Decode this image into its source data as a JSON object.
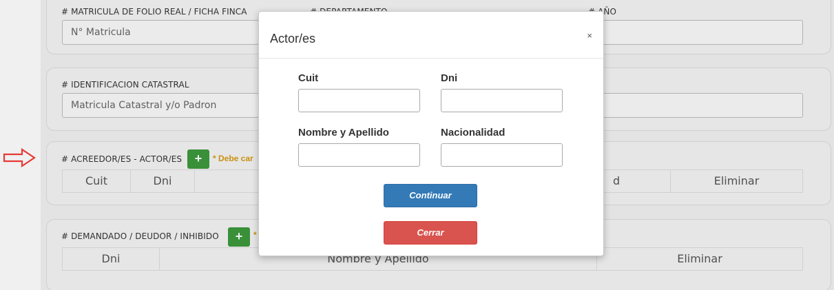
{
  "background": {
    "matricula": {
      "label": "# MATRICULA DE FOLIO REAL / FICHA FINCA",
      "placeholder": "N° Matricula"
    },
    "departamento": {
      "label": "# DEPARTAMENTO"
    },
    "anio": {
      "label": "# AÑO"
    },
    "catastral": {
      "label": "# IDENTIFICACION CATASTRAL",
      "placeholder": "Matricula Catastral y/o Padron"
    },
    "acreedor": {
      "label": "# ACREEDOR/ES - ACTOR/ES",
      "warning": "* Debe car",
      "columns": [
        "Cuit",
        "Dni",
        "",
        "d",
        "Eliminar"
      ]
    },
    "demandado": {
      "label": "# DEMANDADO / DEUDOR / INHIBIDO",
      "warning": "*",
      "columns": [
        "Dni",
        "Nombre y Apellido",
        "Eliminar"
      ]
    }
  },
  "modal": {
    "title": "Actor/es",
    "close": "×",
    "fields": {
      "cuit": "Cuit",
      "dni": "Dni",
      "nombre": "Nombre y Apellido",
      "nacionalidad": "Nacionalidad"
    },
    "buttons": {
      "continuar": "Continuar",
      "cerrar": "Cerrar"
    }
  },
  "colors": {
    "primary": "#337ab7",
    "danger": "#d9534f",
    "success": "#3d9a3d",
    "warning": "#d59a10",
    "arrow": "#e53935"
  },
  "icons": {
    "add": "+",
    "arrow": "right-arrow-outline"
  }
}
